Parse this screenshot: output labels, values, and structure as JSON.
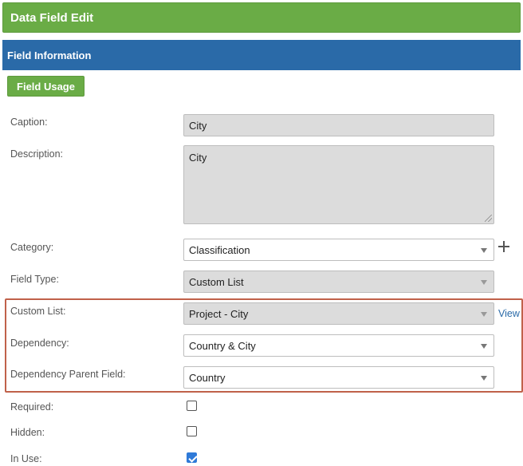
{
  "header": {
    "title": "Data Field Edit"
  },
  "section": {
    "title": "Field Information"
  },
  "toolbar": {
    "field_usage_label": "Field Usage"
  },
  "form": {
    "caption": {
      "label": "Caption:",
      "value": "City"
    },
    "description": {
      "label": "Description:",
      "value": "City"
    },
    "category": {
      "label": "Category:",
      "value": "Classification"
    },
    "field_type": {
      "label": "Field Type:",
      "value": "Custom List"
    },
    "custom_list": {
      "label": "Custom List:",
      "value": "Project - City",
      "view_link": "View"
    },
    "dependency": {
      "label": "Dependency:",
      "value": "Country & City"
    },
    "dependency_parent": {
      "label": "Dependency Parent Field:",
      "value": "Country"
    },
    "required": {
      "label": "Required:",
      "checked": false
    },
    "hidden": {
      "label": "Hidden:",
      "checked": false
    },
    "in_use": {
      "label": "In Use:",
      "checked": true
    }
  },
  "colors": {
    "header_green": "#6aac46",
    "section_blue": "#2a6aa8",
    "highlight_border": "#c0614a",
    "readonly_bg": "#dcdcdc",
    "checkbox_checked": "#2f7ad8"
  }
}
